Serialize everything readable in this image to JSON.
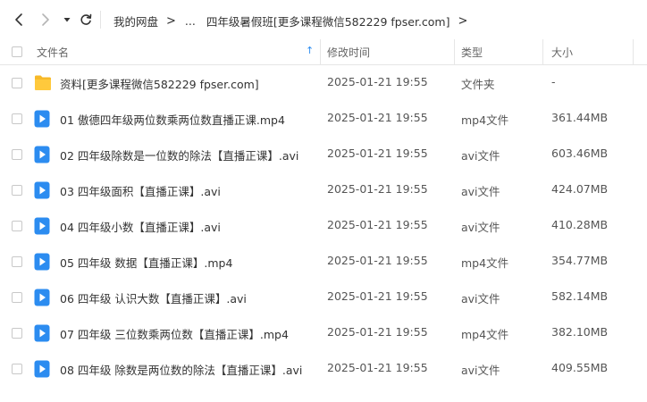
{
  "toolbar": {
    "back_icon": "chevron-left-icon",
    "forward_icon": "chevron-right-icon",
    "history_icon": "caret-down-icon",
    "refresh_icon": "refresh-icon"
  },
  "breadcrumb": {
    "root": "我的网盘",
    "ellipsis": "...",
    "current": "四年级暑假班[更多课程微信582229 fpser.com]",
    "separator": ">"
  },
  "table": {
    "columns": {
      "name": "文件名",
      "modified": "修改时间",
      "type": "类型",
      "size": "大小"
    },
    "sort_indicator": "↑",
    "accent_color": "#2c8cf0",
    "rows": [
      {
        "name": "资料[更多课程微信582229 fpser.com]",
        "modified": "2025-01-21 19:55",
        "type": "文件夹",
        "size": "-",
        "icon": "folder-icon"
      },
      {
        "name": "01 傲德四年级两位数乘两位数直播正课.mp4",
        "modified": "2025-01-21 19:55",
        "type": "mp4文件",
        "size": "361.44MB",
        "icon": "video-file-icon"
      },
      {
        "name": "02 四年级除数是一位数的除法【直播正课】.avi",
        "modified": "2025-01-21 19:55",
        "type": "avi文件",
        "size": "603.46MB",
        "icon": "video-file-icon"
      },
      {
        "name": "03 四年级面积【直播正课】.avi",
        "modified": "2025-01-21 19:55",
        "type": "avi文件",
        "size": "424.07MB",
        "icon": "video-file-icon"
      },
      {
        "name": "04 四年级小数【直播正课】.avi",
        "modified": "2025-01-21 19:55",
        "type": "avi文件",
        "size": "410.28MB",
        "icon": "video-file-icon"
      },
      {
        "name": "05 四年级 数据【直播正课】.mp4",
        "modified": "2025-01-21 19:55",
        "type": "mp4文件",
        "size": "354.77MB",
        "icon": "video-file-icon"
      },
      {
        "name": "06 四年级 认识大数【直播正课】.avi",
        "modified": "2025-01-21 19:55",
        "type": "avi文件",
        "size": "582.14MB",
        "icon": "video-file-icon"
      },
      {
        "name": "07 四年级 三位数乘两位数【直播正课】.mp4",
        "modified": "2025-01-21 19:55",
        "type": "mp4文件",
        "size": "382.10MB",
        "icon": "video-file-icon"
      },
      {
        "name": "08 四年级 除数是两位数的除法【直播正课】.avi",
        "modified": "2025-01-21 19:55",
        "type": "avi文件",
        "size": "409.55MB",
        "icon": "video-file-icon"
      }
    ]
  }
}
